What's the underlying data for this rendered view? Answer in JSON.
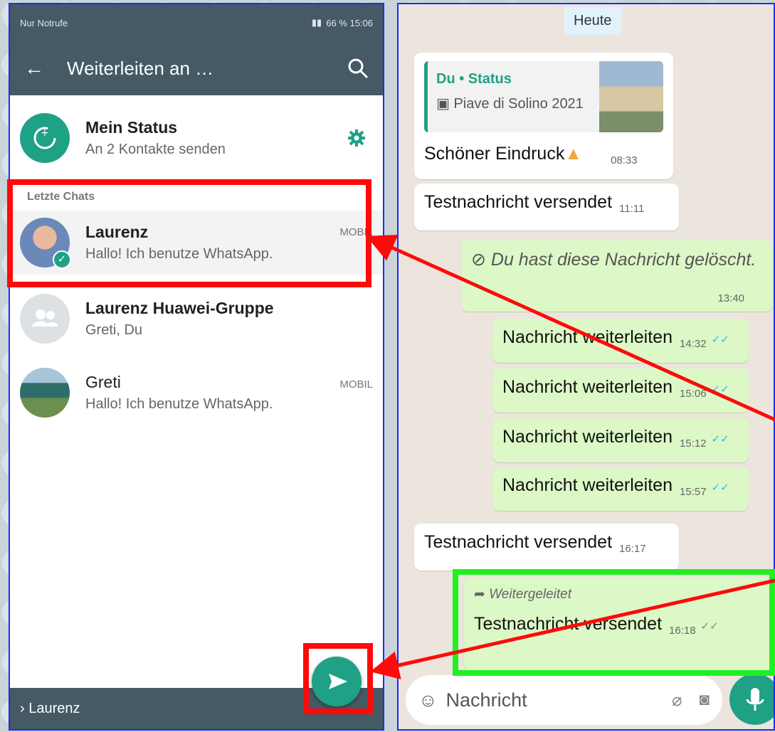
{
  "left": {
    "statusbar": {
      "carrier": "Nur Notrufe",
      "right": "66 %  15:06"
    },
    "appbar": {
      "title": "Weiterleiten an …"
    },
    "status": {
      "title": "Mein Status",
      "subtitle": "An 2 Kontakte senden"
    },
    "section_label": "Letzte Chats",
    "chats": [
      {
        "name": "Laurenz",
        "subtitle": "Hallo! Ich benutze WhatsApp.",
        "tag": "MOBIL"
      },
      {
        "name": "Laurenz Huawei-Gruppe",
        "subtitle": "Greti, Du",
        "tag": ""
      },
      {
        "name": "Greti",
        "subtitle": "Hallo! Ich benutze WhatsApp.",
        "tag": "MOBIL"
      }
    ],
    "bottom": "› Laurenz"
  },
  "right": {
    "date_chip": "Heute",
    "reply": {
      "header": "Du • Status",
      "caption": "Piave di Solino 2021",
      "text": "Schöner Eindruck",
      "time": "08:33"
    },
    "msg_test1": {
      "text": "Testnachricht versendet",
      "time": "11:11"
    },
    "deleted": {
      "text": "Du hast diese Nachricht gelöscht.",
      "time": "13:40"
    },
    "fwd": [
      {
        "text": "Nachricht weiterleiten",
        "time": "14:32"
      },
      {
        "text": "Nachricht weiterleiten",
        "time": "15:06"
      },
      {
        "text": "Nachricht weiterleiten",
        "time": "15:12"
      },
      {
        "text": "Nachricht weiterleiten",
        "time": "15:57"
      }
    ],
    "msg_test2": {
      "text": "Testnachricht versendet",
      "time": "16:17"
    },
    "forwarded": {
      "label": "Weitergeleitet",
      "text": "Testnachricht versendet",
      "time": "16:18"
    },
    "input_placeholder": "Nachricht"
  },
  "colors": {
    "appbar": "#455a64",
    "accent": "#1fa186",
    "annotation_red": "#ff0a0a",
    "annotation_green": "#22ee22",
    "frame": "#1a2bff"
  }
}
